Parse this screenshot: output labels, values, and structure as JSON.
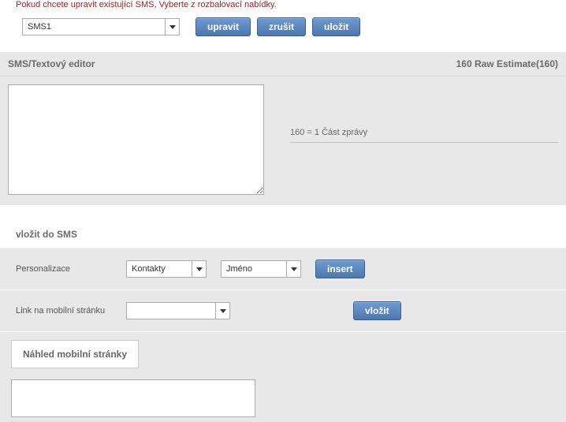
{
  "instruction": "Pokud chcete upravit existující SMS, Vyberte z rozbalovací nabídky.",
  "top": {
    "sms_selected": "SMS1",
    "btn_edit": "upravit",
    "btn_cancel": "zrušit",
    "btn_save": "uložit"
  },
  "editor": {
    "title": "SMS/Textový editor",
    "estimate_label": "160 Raw Estimate(160)",
    "textarea_value": "",
    "info": "160 = 1 Část zprávy"
  },
  "insert_section": {
    "title": "vložit do SMS",
    "row_personalize_label": "Personalizace",
    "select_contacts": "Kontakty",
    "select_name": "Jméno",
    "btn_insert": "insert",
    "row_link_label": "Link na mobilní stránku",
    "select_link": "",
    "btn_vlozit": "vložit",
    "btn_preview": "Náhled mobilní stránky"
  }
}
